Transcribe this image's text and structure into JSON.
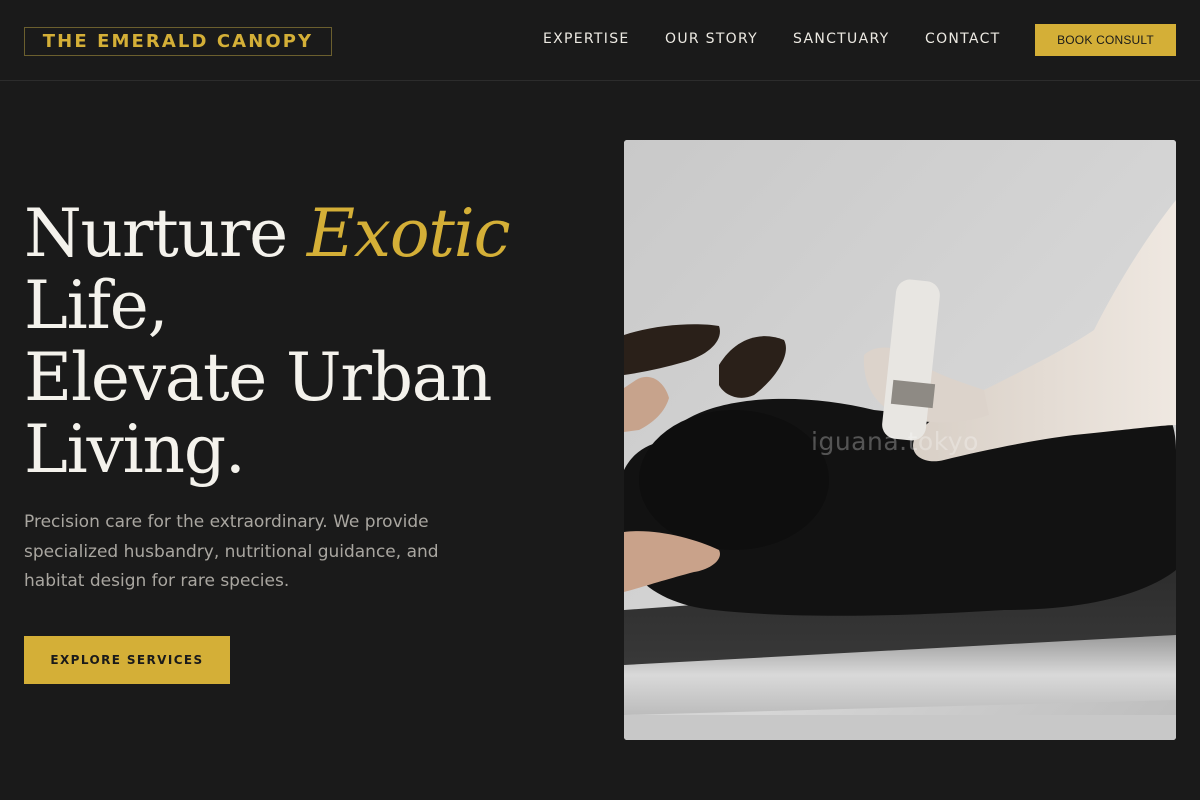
{
  "header": {
    "logo": "THE EMERALD CANOPY",
    "nav": [
      "EXPERTISE",
      "OUR STORY",
      "SANCTUARY",
      "CONTACT"
    ],
    "cta_label": "BOOK CONSULT"
  },
  "hero": {
    "headline_word_1": "Nurture",
    "headline_accent": "Exotic",
    "headline_line_2": "Life,",
    "headline_line_3": "Elevate Urban",
    "headline_line_4": "Living.",
    "tagline": "Precision care for the extraordinary. We provide specialized husbandry, nutritional guidance, and habitat design for rare species.",
    "cta_label": "EXPLORE SERVICES",
    "image_watermark": "iguana.tokyo"
  },
  "colors": {
    "background": "#1a1a1a",
    "accent": "#d4af37",
    "text": "#f4f2ec",
    "muted_text": "#a9a6a0"
  }
}
